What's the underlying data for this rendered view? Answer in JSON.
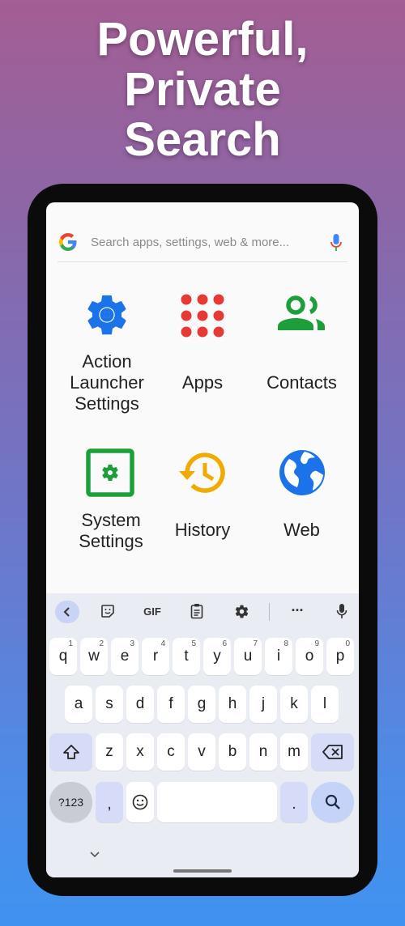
{
  "headline": [
    "Powerful,",
    "Private",
    "Search"
  ],
  "search": {
    "placeholder": "Search apps, settings, web & more..."
  },
  "categories": [
    {
      "label_lines": [
        "Action",
        "Launcher",
        "Settings"
      ],
      "icon": "gear-icon",
      "color": "#1a73e8"
    },
    {
      "label_lines": [
        "Apps"
      ],
      "icon": "apps-grid-icon",
      "color": "#e53935"
    },
    {
      "label_lines": [
        "Contacts"
      ],
      "icon": "contacts-icon",
      "color": "#1e9e3a"
    },
    {
      "label_lines": [
        "System",
        "Settings"
      ],
      "icon": "system-settings-icon",
      "color": "#1e9e3a"
    },
    {
      "label_lines": [
        "History"
      ],
      "icon": "history-icon",
      "color": "#f2a900"
    },
    {
      "label_lines": [
        "Web"
      ],
      "icon": "globe-icon",
      "color": "#1a73e8"
    }
  ],
  "keyboard": {
    "toolbar": {
      "gif": "GIF",
      "more": "..."
    },
    "row1": [
      {
        "k": "q",
        "n": "1"
      },
      {
        "k": "w",
        "n": "2"
      },
      {
        "k": "e",
        "n": "3"
      },
      {
        "k": "r",
        "n": "4"
      },
      {
        "k": "t",
        "n": "5"
      },
      {
        "k": "y",
        "n": "6"
      },
      {
        "k": "u",
        "n": "7"
      },
      {
        "k": "i",
        "n": "8"
      },
      {
        "k": "o",
        "n": "9"
      },
      {
        "k": "p",
        "n": "0"
      }
    ],
    "row2": [
      "a",
      "s",
      "d",
      "f",
      "g",
      "h",
      "j",
      "k",
      "l"
    ],
    "row3": [
      "z",
      "x",
      "c",
      "v",
      "b",
      "n",
      "m"
    ],
    "symbols": "?123",
    "comma": ",",
    "period": "."
  }
}
